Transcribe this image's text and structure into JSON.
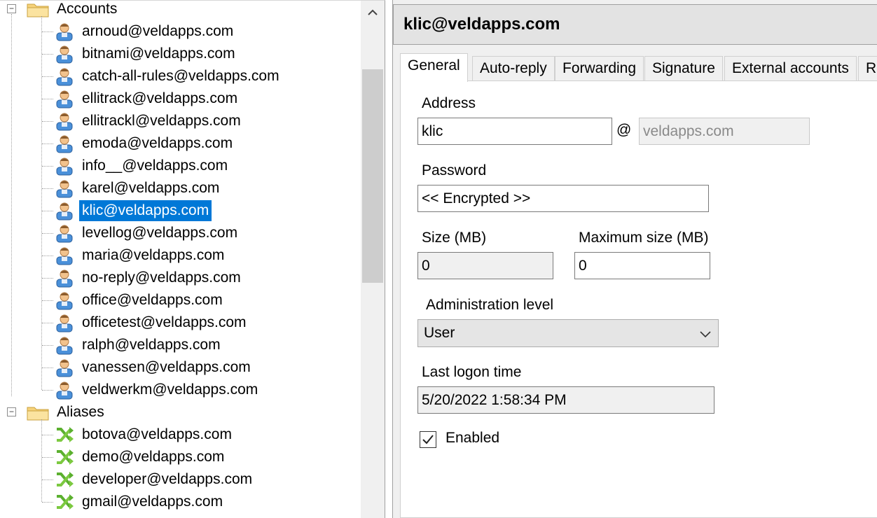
{
  "tree": {
    "groups": [
      {
        "label": "Accounts",
        "expander": "⊟",
        "icon": "folder-icon",
        "items": [
          {
            "label": "arnoud@veldapps.com",
            "icon": "user-icon"
          },
          {
            "label": "bitnami@veldapps.com",
            "icon": "user-icon"
          },
          {
            "label": "catch-all-rules@veldapps.com",
            "icon": "user-icon"
          },
          {
            "label": "ellitrack@veldapps.com",
            "icon": "user-icon"
          },
          {
            "label": "ellitrackl@veldapps.com",
            "icon": "user-icon"
          },
          {
            "label": "emoda@veldapps.com",
            "icon": "user-icon"
          },
          {
            "label": "info__@veldapps.com",
            "icon": "user-icon"
          },
          {
            "label": "karel@veldapps.com",
            "icon": "user-icon"
          },
          {
            "label": "klic@veldapps.com",
            "icon": "user-icon",
            "selected": true
          },
          {
            "label": "levellog@veldapps.com",
            "icon": "user-icon"
          },
          {
            "label": "maria@veldapps.com",
            "icon": "user-icon"
          },
          {
            "label": "no-reply@veldapps.com",
            "icon": "user-icon"
          },
          {
            "label": "office@veldapps.com",
            "icon": "user-icon"
          },
          {
            "label": "officetest@veldapps.com",
            "icon": "user-icon"
          },
          {
            "label": "ralph@veldapps.com",
            "icon": "user-icon"
          },
          {
            "label": "vanessen@veldapps.com",
            "icon": "user-icon"
          },
          {
            "label": "veldwerkm@veldapps.com",
            "icon": "user-icon"
          }
        ]
      },
      {
        "label": "Aliases",
        "expander": "⊟",
        "icon": "folder-icon",
        "items": [
          {
            "label": "botova@veldapps.com",
            "icon": "alias-icon"
          },
          {
            "label": "demo@veldapps.com",
            "icon": "alias-icon"
          },
          {
            "label": "developer@veldapps.com",
            "icon": "alias-icon"
          },
          {
            "label": "gmail@veldapps.com",
            "icon": "alias-icon"
          }
        ]
      }
    ]
  },
  "detail": {
    "title": "klic@veldapps.com",
    "tabs": [
      {
        "label": "General",
        "active": true
      },
      {
        "label": "Auto-reply"
      },
      {
        "label": "Forwarding"
      },
      {
        "label": "Signature"
      },
      {
        "label": "External accounts"
      },
      {
        "label": "R"
      }
    ],
    "address_label": "Address",
    "address_value": "klic",
    "at_sign": "@",
    "domain_value": "veldapps.com",
    "password_label": "Password",
    "password_value": "<< Encrypted >>",
    "size_label": "Size (MB)",
    "size_value": "0",
    "max_size_label": "Maximum size (MB)",
    "max_size_value": "0",
    "admin_level_label": "Administration level",
    "admin_level_value": "User",
    "last_logon_label": "Last logon time",
    "last_logon_value": "5/20/2022 1:58:34 PM",
    "enabled_label": "Enabled",
    "enabled_checked": true
  },
  "colors": {
    "selection": "#0078d7",
    "panel_bg": "#f0f0f0",
    "header_bg": "#e3e3e3"
  }
}
